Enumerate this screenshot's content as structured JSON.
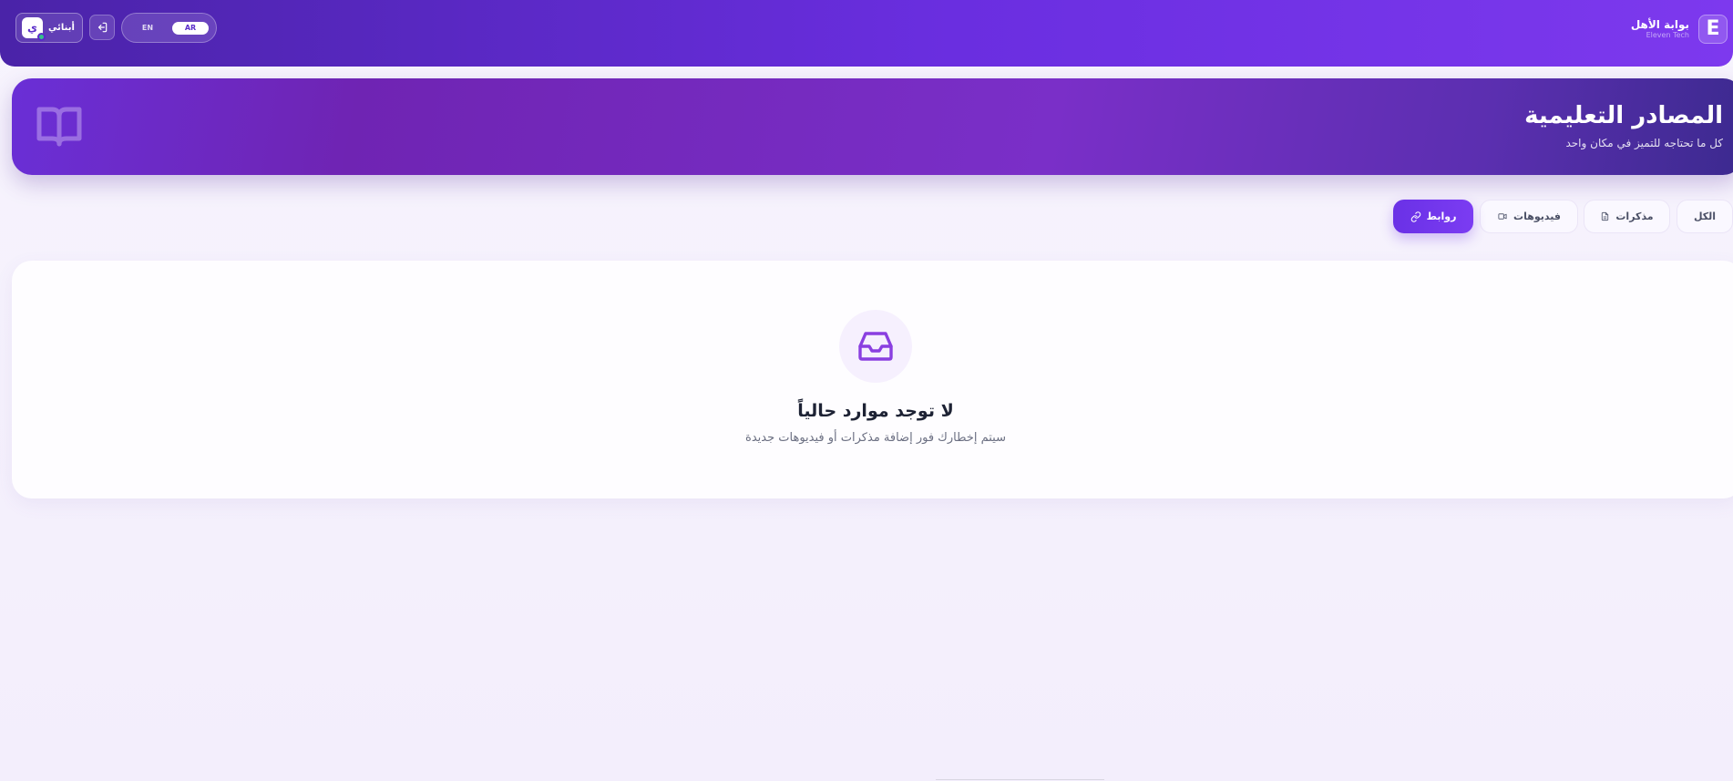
{
  "header": {
    "brand_title": "بوابة الأهل",
    "brand_subtitle": "Eleven Tech",
    "brand_logo_letter": "E",
    "user_name": "أبنائي",
    "user_initial": "ي",
    "lang_options": [
      "EN",
      "AR"
    ],
    "lang_active": "AR",
    "logout_icon": "logout-icon"
  },
  "hero": {
    "title": "المصادر التعليمية",
    "subtitle": "كل ما تحتاجه للتميز في مكان واحد",
    "icon": "book-open-icon"
  },
  "tabs": [
    {
      "label": "الكل",
      "icon": "",
      "active": false
    },
    {
      "label": "مذكرات",
      "icon": "file-icon",
      "active": false
    },
    {
      "label": "فيديوهات",
      "icon": "video-icon",
      "active": false
    },
    {
      "label": "روابط",
      "icon": "link-icon",
      "active": true
    }
  ],
  "empty_state": {
    "icon": "inbox-icon",
    "title": "لا توجد موارد حالياً",
    "subtitle": "سيتم إخطارك فور إضافة مذكرات أو فيديوهات جديدة"
  },
  "colors": {
    "primary": "#6a2ee0",
    "accent": "#7b3cf2",
    "online": "#35c28a"
  }
}
